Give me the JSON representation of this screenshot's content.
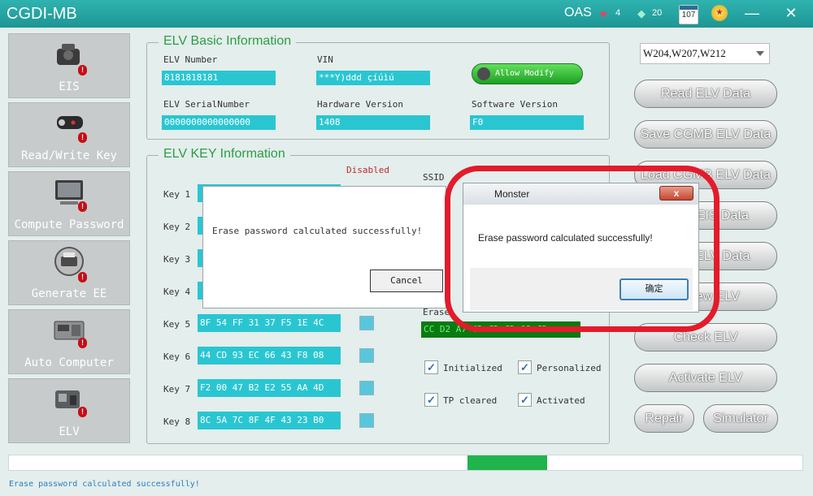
{
  "titlebar": {
    "app_title": "CGDI-MB",
    "oas": "OAS",
    "heart_count": "4",
    "gem_count": "20",
    "calendar_day": "107",
    "minimize": "—",
    "close": "✕"
  },
  "sidebar": {
    "items": [
      {
        "label": "EIS",
        "icon": "ignition-key-icon"
      },
      {
        "label": "Read/Write Key",
        "icon": "car-key-icon"
      },
      {
        "label": "Compute Password",
        "icon": "computer-icon"
      },
      {
        "label": "Generate EE",
        "icon": "printer-icon"
      },
      {
        "label": "Auto Computer",
        "icon": "ecu-icon"
      },
      {
        "label": "ELV",
        "icon": "steering-lock-icon"
      }
    ]
  },
  "basic_info": {
    "title": "ELV Basic Information",
    "elv_number_label": "ELV Number",
    "elv_number": "8181818181",
    "vin_label": "VIN",
    "vin": "***Y)ddd çíúìú",
    "allow_modify": "Allow Modify",
    "serial_label": "ELV SerialNumber",
    "serial": "0000000000000000",
    "hw_label": "Hardware Version",
    "hw": "1408",
    "sw_label": "Software Version",
    "sw": "F0"
  },
  "key_info": {
    "title": "ELV KEY Information",
    "disabled_label": "Disabled",
    "ssid_label": "SSID",
    "erase_label": "Erase",
    "erase_value": "CC D2 A7 CD CD CD 03 CD",
    "keys": [
      {
        "label": "Key 1",
        "value": "",
        "disabled": false
      },
      {
        "label": "Key 2",
        "value": "",
        "disabled": false
      },
      {
        "label": "Key 3",
        "value": "",
        "disabled": false
      },
      {
        "label": "Key 4",
        "value": "",
        "disabled": false
      },
      {
        "label": "Key 5",
        "value": "8F 54 FF 31 37 F5 1E 4C",
        "disabled": false
      },
      {
        "label": "Key 6",
        "value": "44 CD 93 EC 66 43 F8 08",
        "disabled": false
      },
      {
        "label": "Key 7",
        "value": "F2 00 47 B2 E2 55 AA 4D",
        "disabled": false
      },
      {
        "label": "Key 8",
        "value": "8C 5A 7C 8F 4F 43 23 B0",
        "disabled": false
      }
    ],
    "checks": [
      {
        "label": "Initialized",
        "checked": true
      },
      {
        "label": "Personalized",
        "checked": true
      },
      {
        "label": "TP cleared",
        "checked": true
      },
      {
        "label": "Activated",
        "checked": true
      }
    ]
  },
  "right_panel": {
    "model_select": "W204,W207,W212",
    "buttons": [
      "Read  ELV Data",
      "Save CGMB ELV Data",
      "Load CGMB ELV Data",
      "Write EIS Data",
      "Write ELV Data",
      "Renew ELV",
      "Check ELV",
      "Activate ELV"
    ],
    "repair": "Repair",
    "simulator": "Simulator"
  },
  "progress": {
    "fill_start": 0.578,
    "fill_end": 0.678,
    "color": "#1fb44c"
  },
  "status_text": "Erase password calculated successfully!",
  "dialog_app": {
    "message": "Erase password calculated successfully!",
    "cancel": "Cancel"
  },
  "dialog_system": {
    "title": "Monster",
    "message": "Erase password calculated successfully!",
    "ok": "确定",
    "close": "x"
  },
  "colors": {
    "accent": "#29c6d2",
    "title_green": "#2a9d46",
    "annotation_red": "#e31b2b",
    "titlebar": "#1d9694"
  }
}
